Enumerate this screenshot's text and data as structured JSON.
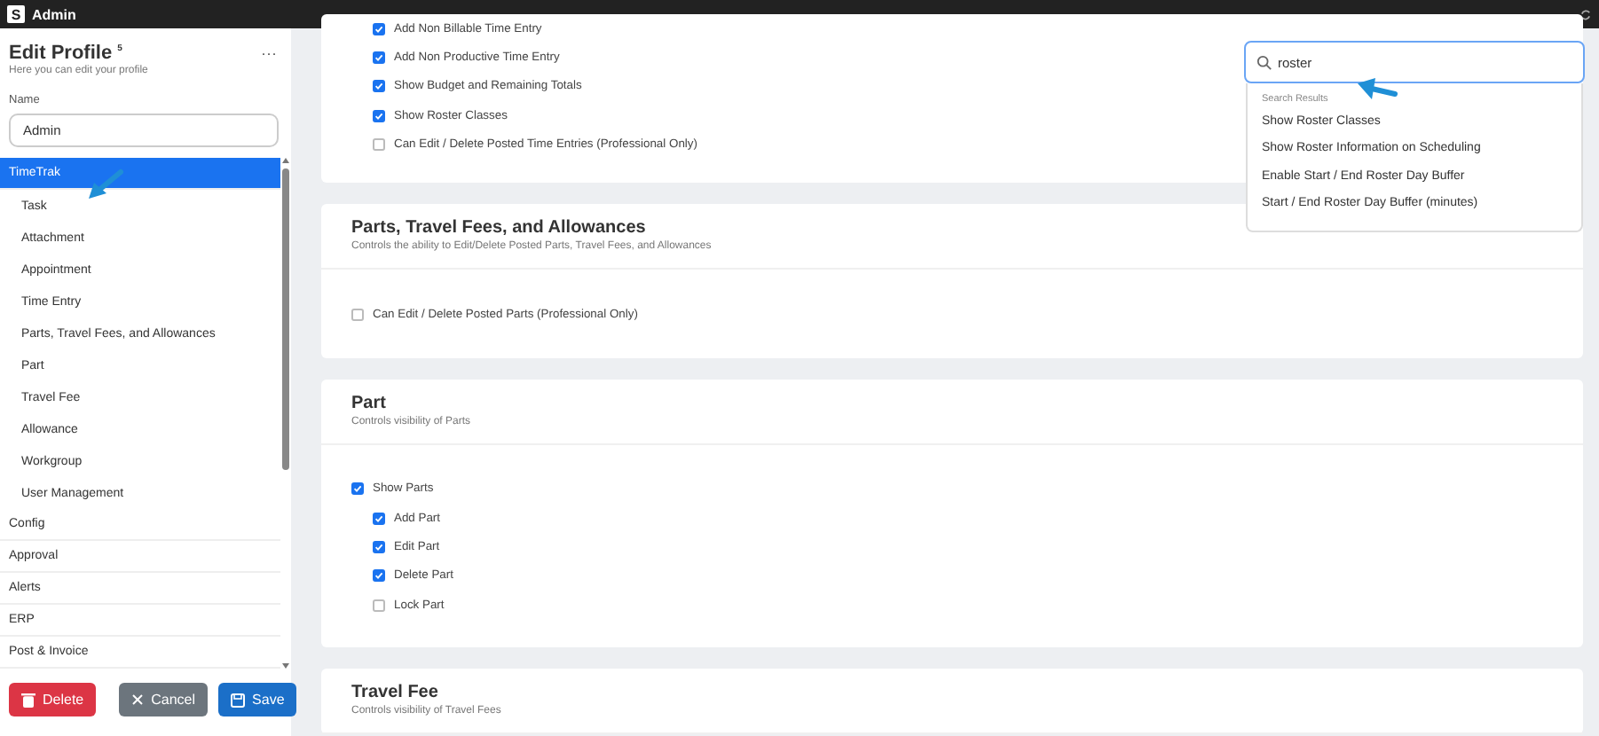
{
  "app": {
    "logo": "S",
    "title": "Admin"
  },
  "sidebar": {
    "title": "Edit Profile $^{5}$",
    "subtitle": "Here you can edit your profile",
    "more": "···",
    "name_label": "Name",
    "name_value": "Admin",
    "nav": [
      {
        "label": "TimeTrak",
        "selected": true,
        "children": [
          {
            "label": "Task",
            "selected": false
          },
          {
            "label": "Attachment",
            "selected": false
          },
          {
            "label": "Appointment",
            "selected": false
          },
          {
            "label": "Time Entry",
            "selected": false
          },
          {
            "label": "Parts, Travel Fees, and Allowances",
            "selected": false
          },
          {
            "label": "Part",
            "selected": false
          },
          {
            "label": "Travel Fee",
            "selected": false
          },
          {
            "label": "Allowance",
            "selected": false
          },
          {
            "label": "Workgroup",
            "selected": false
          },
          {
            "label": "User Management",
            "selected": false
          }
        ]
      },
      {
        "label": "Config",
        "selected": false
      },
      {
        "label": "Approval",
        "selected": false
      },
      {
        "label": "Alerts",
        "selected": false
      },
      {
        "label": "ERP",
        "selected": false
      },
      {
        "label": "Post & Invoice",
        "selected": false
      }
    ],
    "buttons": [
      {
        "kind": "delete",
        "label": "Delete"
      },
      {
        "kind": "cancel",
        "label": "Cancel"
      },
      {
        "kind": "save",
        "label": "Save"
      }
    ]
  },
  "sections": [
    {
      "options": [
        {
          "label": "Add Non Billable Time Entry",
          "checked": true
        },
        {
          "label": "Add Non Productive Time Entry",
          "checked": true
        },
        {
          "label": "Show Budget and Remaining Totals",
          "checked": true
        },
        {
          "label": "Show Roster Classes",
          "checked": true
        },
        {
          "label": "Can Edit / Delete Posted Time Entries (Professional Only)",
          "checked": false
        }
      ]
    },
    {
      "title": "Parts, Travel Fees, and Allowances",
      "subtitle": "Controls the ability to Edit/Delete Posted Parts, Travel Fees, and Allowances",
      "options": [
        {
          "label": "Can Edit / Delete Posted Parts (Professional Only)",
          "checked": false
        }
      ]
    },
    {
      "title": "Part",
      "subtitle": "Controls visibility of Parts",
      "options": [
        {
          "label": "Show Parts",
          "checked": true,
          "children": [
            {
              "label": "Add Part",
              "checked": true
            },
            {
              "label": "Edit Part",
              "checked": true
            },
            {
              "label": "Delete Part",
              "checked": true
            },
            {
              "label": "Lock Part",
              "checked": false
            }
          ]
        }
      ]
    },
    {
      "title": "Travel Fee",
      "subtitle": "Controls visibility of Travel Fees"
    }
  ],
  "search": {
    "value": "roster",
    "results_heading": "Search Results",
    "results": [
      "Show Roster Classes",
      "Show Roster Information on Scheduling",
      "Enable Start / End Roster Day Buffer",
      "Start / End Roster Day Buffer (minutes)"
    ]
  }
}
